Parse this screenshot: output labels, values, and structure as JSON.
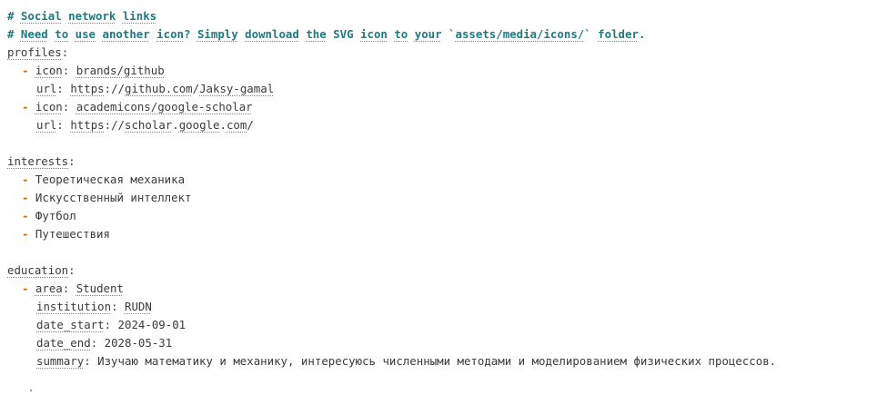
{
  "comments": {
    "c1_hash": "# ",
    "c1_w1": "Social",
    "c1_w2": "network",
    "c1_w3": "links",
    "c2_hash": "# ",
    "c2_w1": "Need",
    "c2_w2": "to",
    "c2_w3": "use",
    "c2_w4": "another",
    "c2_w5": "icon",
    "c2_q": "? ",
    "c2_w6": "Simply",
    "c2_w7": "download",
    "c2_w8": "the",
    "c2_svg": " SVG ",
    "c2_w9": "icon",
    "c2_w10": "to",
    "c2_w11": "your",
    "c2_path_open": " `",
    "c2_path": "assets/media/icons/",
    "c2_path_close": "` ",
    "c2_w12": "folder",
    "c2_dot": "."
  },
  "profiles": {
    "key": "profiles",
    "items": [
      {
        "icon_key": "icon",
        "icon_val": "brands/github",
        "url_key": "url",
        "url_scheme": "https",
        "url_rest_a": "://",
        "url_host": "github.com",
        "url_rest_b": "/",
        "url_user": "Jaksy-gamal"
      },
      {
        "icon_key": "icon",
        "icon_val": "academicons/google-scholar",
        "url_key": "url",
        "url_scheme": "https",
        "url_rest_a": "://",
        "url_host_a": "scholar",
        "url_host_b": "google",
        "url_host_c": "com",
        "url_rest_b": "/"
      }
    ]
  },
  "interests": {
    "key": "interests",
    "items": [
      "Теоретическая механика",
      "Искусственный интеллект",
      "Футбол",
      "Путешествия"
    ]
  },
  "education": {
    "key": "education",
    "area_key": "area",
    "area_val": "Student",
    "institution_key": "institution",
    "institution_val": "RUDN",
    "date_start_key": "date_start",
    "date_start_val": "2024-09-01",
    "date_end_key": "date_end",
    "date_end_val": "2028-05-31",
    "summary_key": "summary",
    "summary_val": "Изучаю математику и механику, интересуюсь численными методами и моделированием физических процессов."
  },
  "syntax": {
    "colon": ": ",
    "colon_end": ":",
    "dash": "- ",
    "dot": "."
  },
  "colors": {
    "comment": "#1f7a84",
    "dash": "#c5690e",
    "text": "#3b3b3b",
    "spellcheck_underline": "#e05a5a"
  }
}
